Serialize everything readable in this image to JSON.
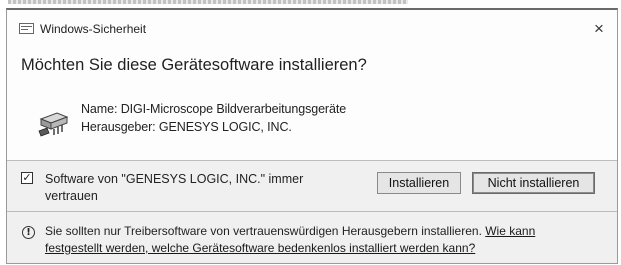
{
  "window": {
    "title": "Windows-Sicherheit",
    "close_glyph": "×",
    "title_icon": "window-icon"
  },
  "prompt": {
    "heading": "Möchten Sie diese Gerätesoftware installieren?"
  },
  "device": {
    "icon": "device-driver-icon",
    "name_line": "Name: DIGI-Microscope Bildverarbeitungsgeräte",
    "publisher_line": "Herausgeber: GENESYS LOGIC, INC."
  },
  "trust": {
    "checked": true,
    "check_glyph": "✓",
    "label": "Software von \"GENESYS LOGIC, INC.\" immer vertrauen"
  },
  "buttons": {
    "install_label": "Installieren",
    "no_install_label": "Nicht installieren"
  },
  "info": {
    "icon": "info-shield-icon",
    "icon_glyph": "!",
    "text": "Sie sollten nur Treibersoftware von vertrauenswürdigen Herausgebern installieren. ",
    "link_text": "Wie kann festgestellt werden, welche Gerätesoftware bedenkenlos installiert werden kann?"
  }
}
